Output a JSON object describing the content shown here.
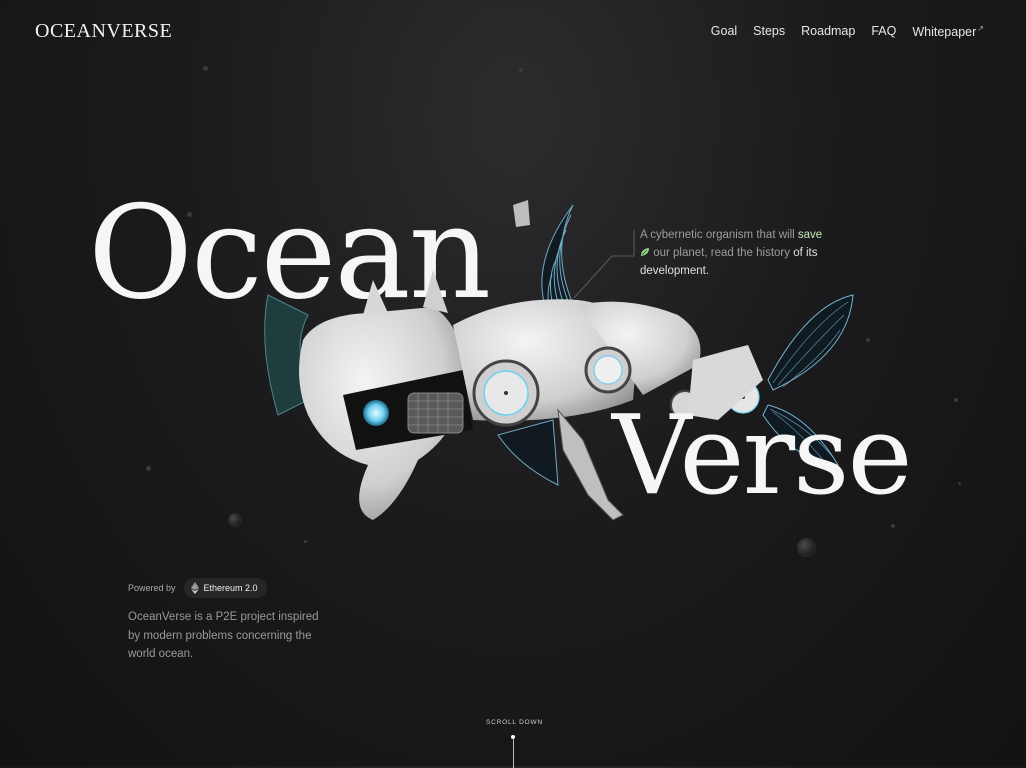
{
  "brand": {
    "logo": "OCEANVERSE"
  },
  "nav": {
    "items": [
      {
        "label": "Goal"
      },
      {
        "label": "Steps"
      },
      {
        "label": "Roadmap"
      },
      {
        "label": "FAQ"
      },
      {
        "label": "Whitepaper"
      }
    ],
    "whitepaper_icon": "arrow-up-right-icon"
  },
  "hero": {
    "title_part1": "Ocean",
    "title_part2": "Verse",
    "tagline": {
      "pre": "A cybernetic organism that will",
      "highlight": "save",
      "mid": "our planet, read the history",
      "post": "of its development."
    },
    "tagline_icon": "leaf-icon",
    "fish_icon": "robotic-fish-illustration"
  },
  "powered": {
    "label": "Powered by",
    "chip": "Ethereum 2.0",
    "chip_icon": "ethereum-icon"
  },
  "about": "OceanVerse is a P2E project inspired by modern problems concerning the world ocean.",
  "scroll": {
    "label": "SCROLL DOWN"
  },
  "colors": {
    "background": "#161617",
    "accent": "#c9e7b5",
    "fin": "#7fc3e4"
  }
}
